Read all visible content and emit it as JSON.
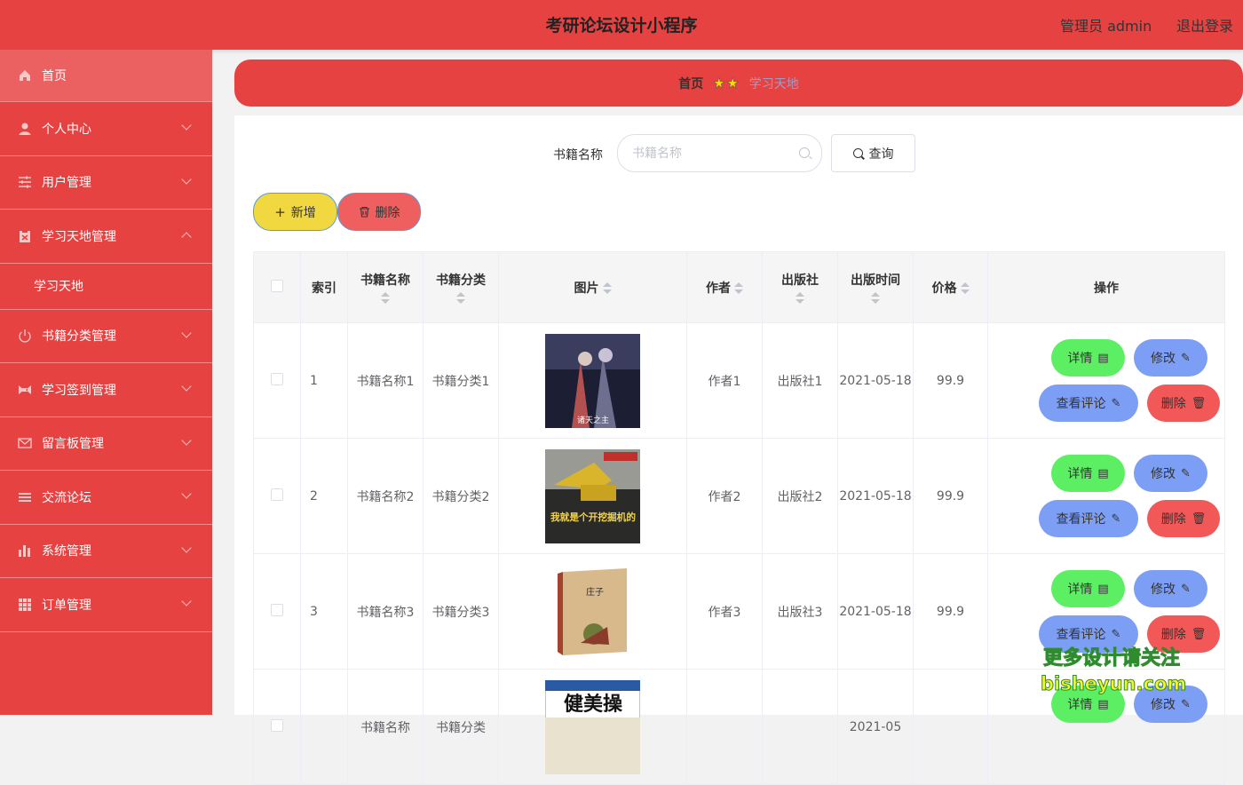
{
  "header": {
    "title": "考研论坛设计小程序",
    "user": "管理员 admin",
    "logout": "退出登录"
  },
  "sidebar": {
    "items": [
      {
        "label": "首页",
        "icon": "home-icon"
      },
      {
        "label": "个人中心",
        "icon": "user-icon"
      },
      {
        "label": "用户管理",
        "icon": "sliders-icon"
      },
      {
        "label": "学习天地管理",
        "icon": "clipboard-icon"
      },
      {
        "label": "书籍分类管理",
        "icon": "power-icon"
      },
      {
        "label": "学习签到管理",
        "icon": "ticket-icon"
      },
      {
        "label": "留言板管理",
        "icon": "mail-icon"
      },
      {
        "label": "交流论坛",
        "icon": "list-icon"
      },
      {
        "label": "系统管理",
        "icon": "bar-chart-icon"
      },
      {
        "label": "订单管理",
        "icon": "grid-icon"
      }
    ],
    "sub_label": "学习天地"
  },
  "breadcrumb": {
    "home": "首页",
    "current": "学习天地"
  },
  "search": {
    "label": "书籍名称",
    "placeholder": "书籍名称",
    "button": "查询"
  },
  "actions": {
    "add": "新增",
    "delete": "删除"
  },
  "table": {
    "headers": [
      "索引",
      "书籍名称",
      "书籍分类",
      "图片",
      "作者",
      "出版社",
      "出版时间",
      "价格",
      "操作"
    ],
    "rows": [
      {
        "index": "1",
        "name": "书籍名称1",
        "category": "书籍分类1",
        "author": "作者1",
        "publisher": "出版社1",
        "date": "2021-05-18",
        "price": "99.9",
        "cover": "dark-anime-cover"
      },
      {
        "index": "2",
        "name": "书籍名称2",
        "category": "书籍分类2",
        "author": "作者2",
        "publisher": "出版社2",
        "date": "2021-05-18",
        "price": "99.9",
        "cover": "excavator-cover"
      },
      {
        "index": "3",
        "name": "书籍名称3",
        "category": "书籍分类3",
        "author": "作者3",
        "publisher": "出版社3",
        "date": "2021-05-18",
        "price": "99.9",
        "cover": "zhuangzi-cover"
      },
      {
        "index": "",
        "name": "书籍名称",
        "category": "书籍分类",
        "author": "",
        "publisher": "",
        "date": "2021-05",
        "price": "",
        "cover": "fitness-cover"
      }
    ],
    "row_actions": {
      "detail": "详情",
      "edit": "修改",
      "comments": "查看评论",
      "delete": "删除"
    }
  },
  "covers": {
    "c1_text": "诸天之主",
    "c2_text": "我就是个开挖掘机的",
    "c3_text": "庄子",
    "c4_text": "健美操"
  },
  "watermark": {
    "line1": "更多设计请关注",
    "line2": "bisheyun.com"
  },
  "colors": {
    "primary": "#e74242",
    "green": "#5cef63",
    "blue": "#7c9ff5",
    "red": "#f25858",
    "yellow": "#f1d841"
  }
}
